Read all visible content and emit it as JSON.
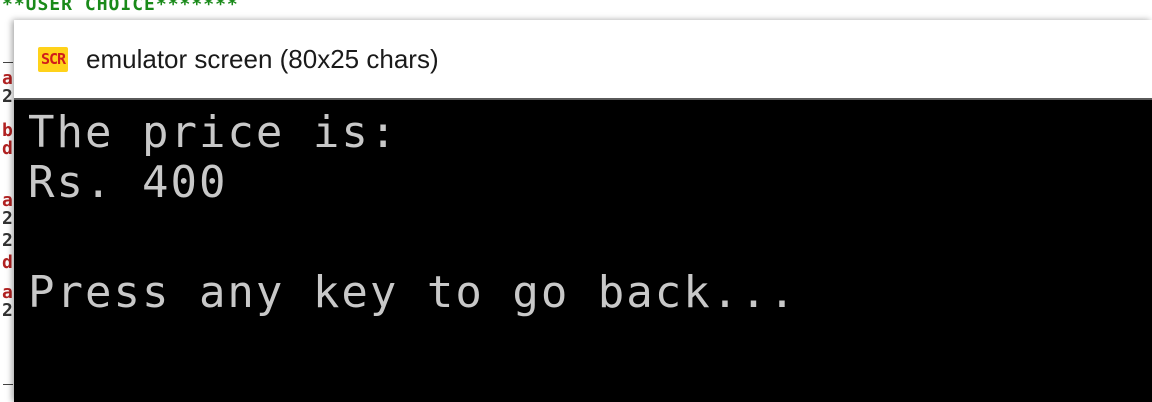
{
  "background": {
    "top_text": "**USER CHOICE*******",
    "gutter_chars": [
      {
        "char": "a",
        "color": "#b22222"
      },
      {
        "char": "2",
        "color": "#333333"
      },
      {
        "char": "b",
        "color": "#b22222"
      },
      {
        "char": "d",
        "color": "#b22222"
      },
      {
        "char": "a",
        "color": "#b22222"
      },
      {
        "char": "2",
        "color": "#333333"
      },
      {
        "char": "2",
        "color": "#333333"
      },
      {
        "char": "d",
        "color": "#b22222"
      },
      {
        "char": "a",
        "color": "#b22222"
      },
      {
        "char": "2",
        "color": "#333333"
      }
    ]
  },
  "window": {
    "title": "emulator screen (80x25 chars)",
    "icon": "scr-app-icon",
    "icon_label": "SCR"
  },
  "screen": {
    "lines": [
      "The price is:",
      "Rs. 400",
      "",
      "Press any key to go back..."
    ],
    "text_color": "#c8c8c8",
    "background_color": "#000000"
  }
}
